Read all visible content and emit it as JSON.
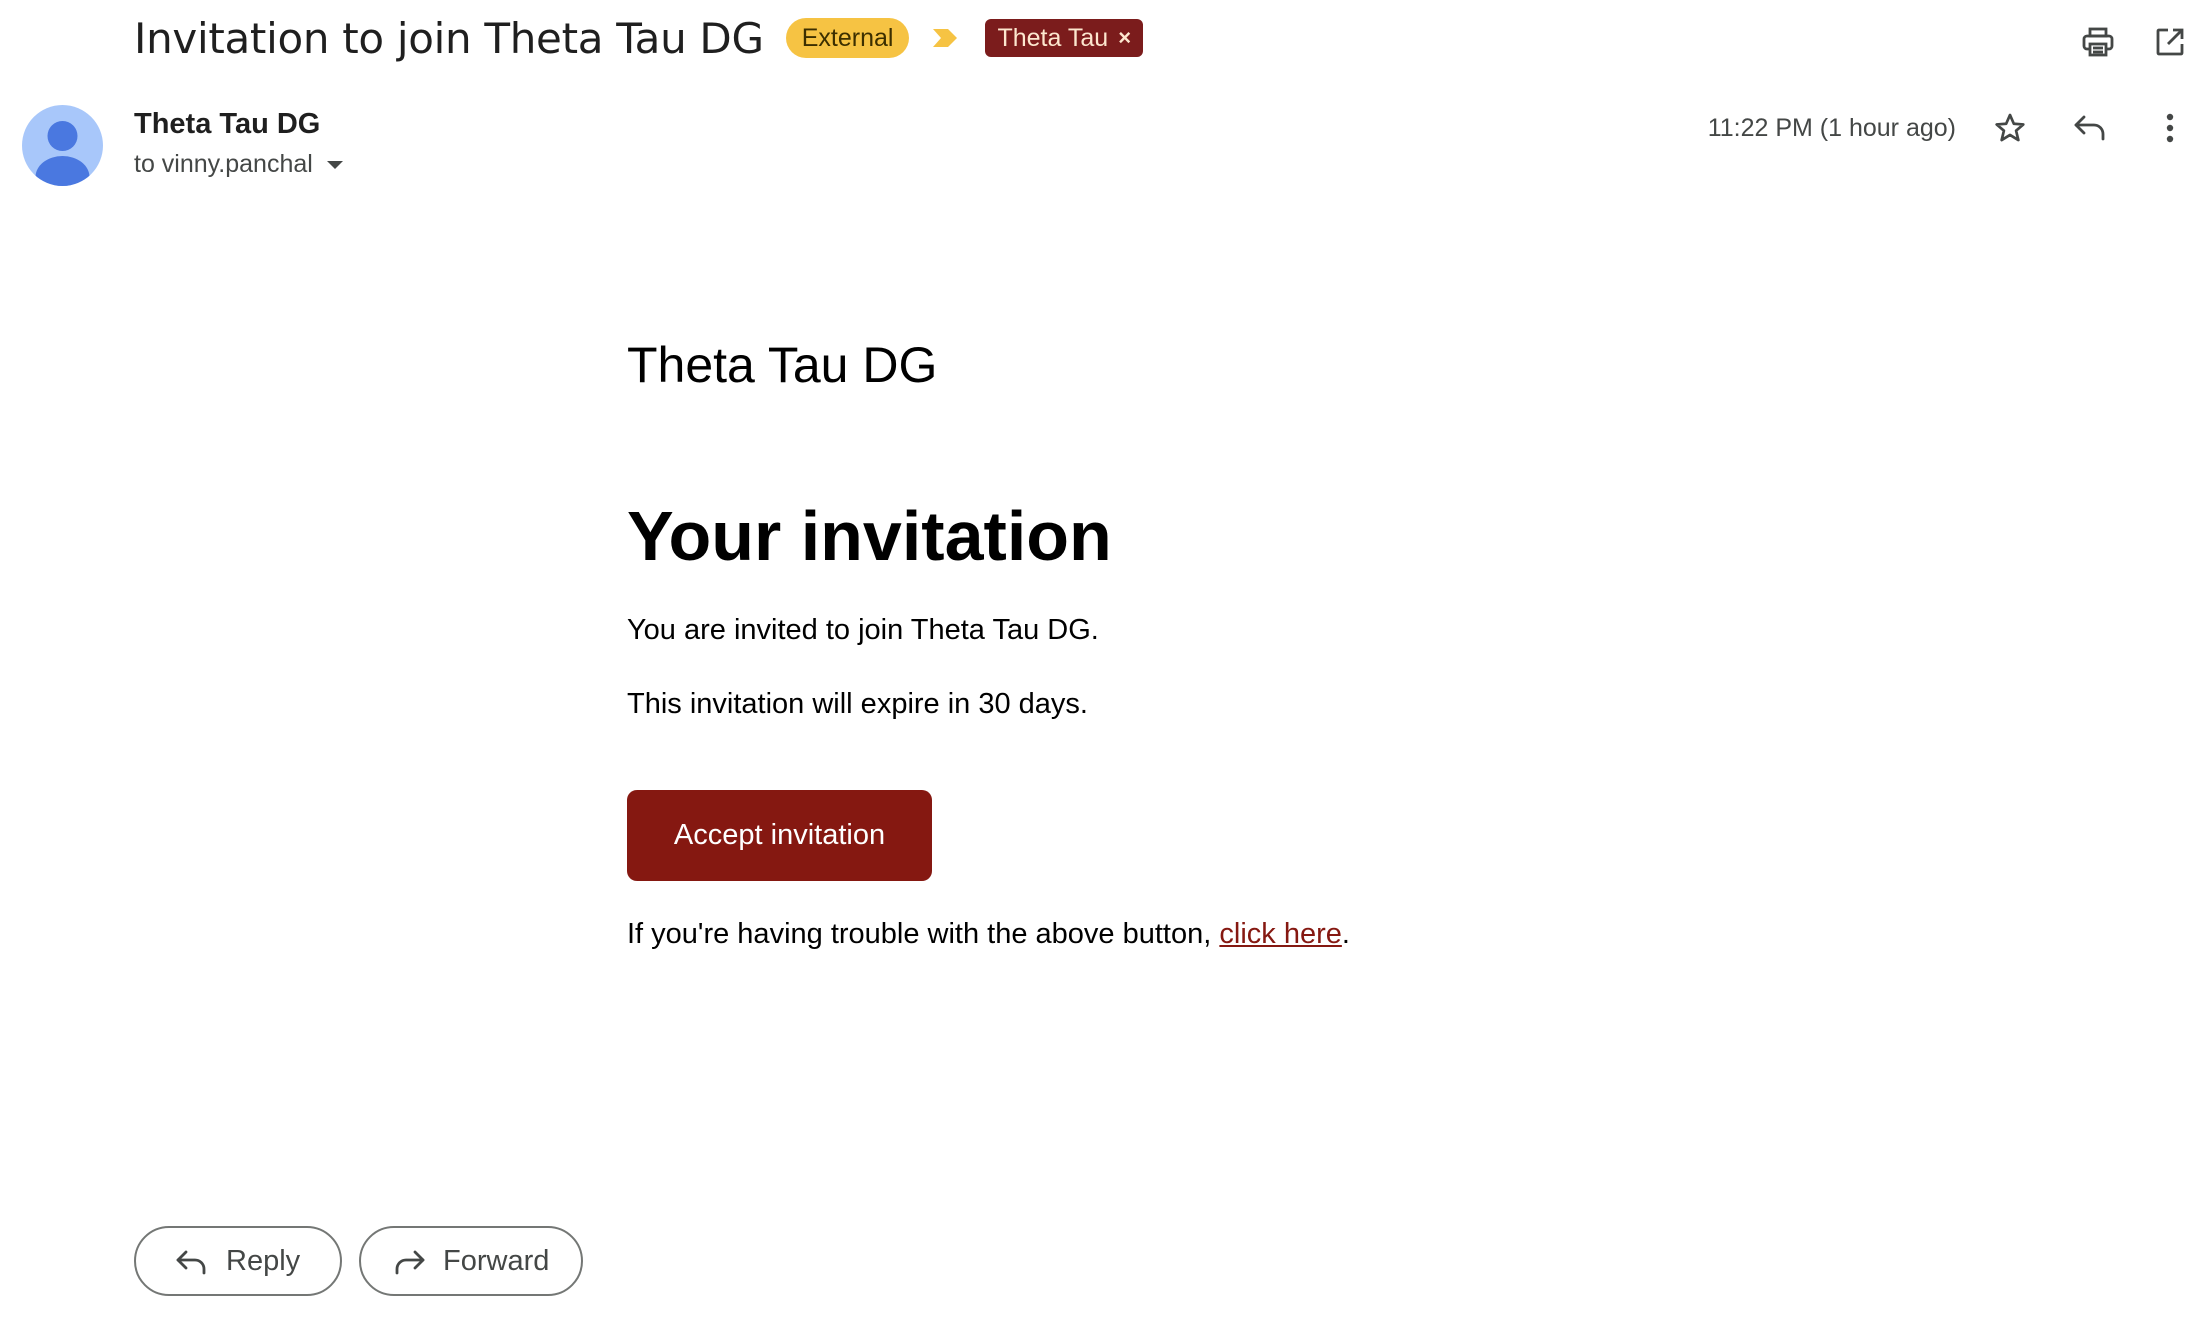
{
  "subject": {
    "title": "Invitation to join Theta Tau DG",
    "labels": {
      "external": "External",
      "theta_tau": "Theta Tau",
      "remove_symbol": "×"
    }
  },
  "top_actions": {
    "print_icon": "print-icon",
    "open_new_window_icon": "open-in-new-window-icon"
  },
  "sender": {
    "name": "Theta Tau DG",
    "recipient_line": "to vinny.panchal",
    "timestamp": "11:22 PM (1 hour ago)"
  },
  "message_actions": {
    "star_icon": "star-icon",
    "reply_icon": "reply-icon",
    "more_icon": "more-vertical-icon"
  },
  "email_body": {
    "brand": "Theta Tau DG",
    "heading": "Your invitation",
    "invite_text": "You are invited to join Theta Tau DG.",
    "expire_text": "This invitation will expire in 30 days.",
    "accept_button": "Accept invitation",
    "trouble_prefix": "If you're having trouble with the above button, ",
    "trouble_link": "click here",
    "trouble_suffix": "."
  },
  "bottom_actions": {
    "reply_label": "Reply",
    "forward_label": "Forward"
  },
  "colors": {
    "external_label_bg": "#f6c343",
    "theta_label_bg": "#7b1c1c",
    "accept_button_bg": "#851811",
    "avatar_bg": "#a8c7fa",
    "avatar_figure": "#4a78e0"
  }
}
